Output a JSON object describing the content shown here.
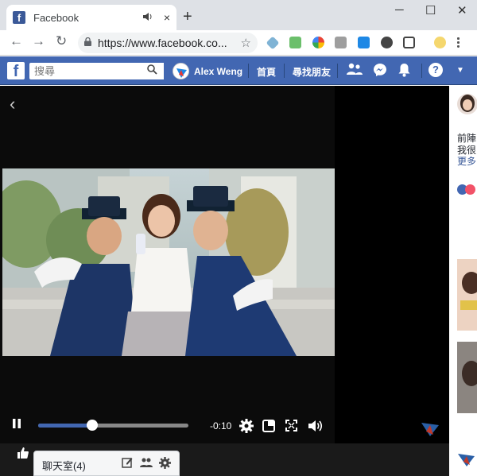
{
  "browser": {
    "tab_title": "Facebook",
    "favicon_letter": "f",
    "speaker_icon": "speaker-icon",
    "close_glyph": "×",
    "newtab_glyph": "+",
    "url": "https://www.facebook.co...",
    "minimize_glyph": "─",
    "maximize_glyph": "☐",
    "close_window_glyph": "✕",
    "back_glyph": "←",
    "forward_glyph": "→",
    "reload_glyph": "↻",
    "lock_glyph": "🔒",
    "star_glyph": "☆"
  },
  "fb": {
    "logo": "f",
    "search_placeholder": "搜尋",
    "user_name": "Alex Weng",
    "nav_home": "首頁",
    "nav_find_friends": "尋找朋友",
    "help_glyph": "?",
    "caret_glyph": "▼"
  },
  "player": {
    "back_glyph": "‹",
    "time": "-0:10",
    "progress": 0.36
  },
  "chat": {
    "label": "聊天室(4)"
  },
  "sidebar": {
    "line1": "前陣",
    "line2": "我很",
    "more": "更多"
  },
  "colors": {
    "fb_blue": "#4267b2",
    "tab_strip": "#dee1e6",
    "player_bg": "#0b0b0b"
  }
}
